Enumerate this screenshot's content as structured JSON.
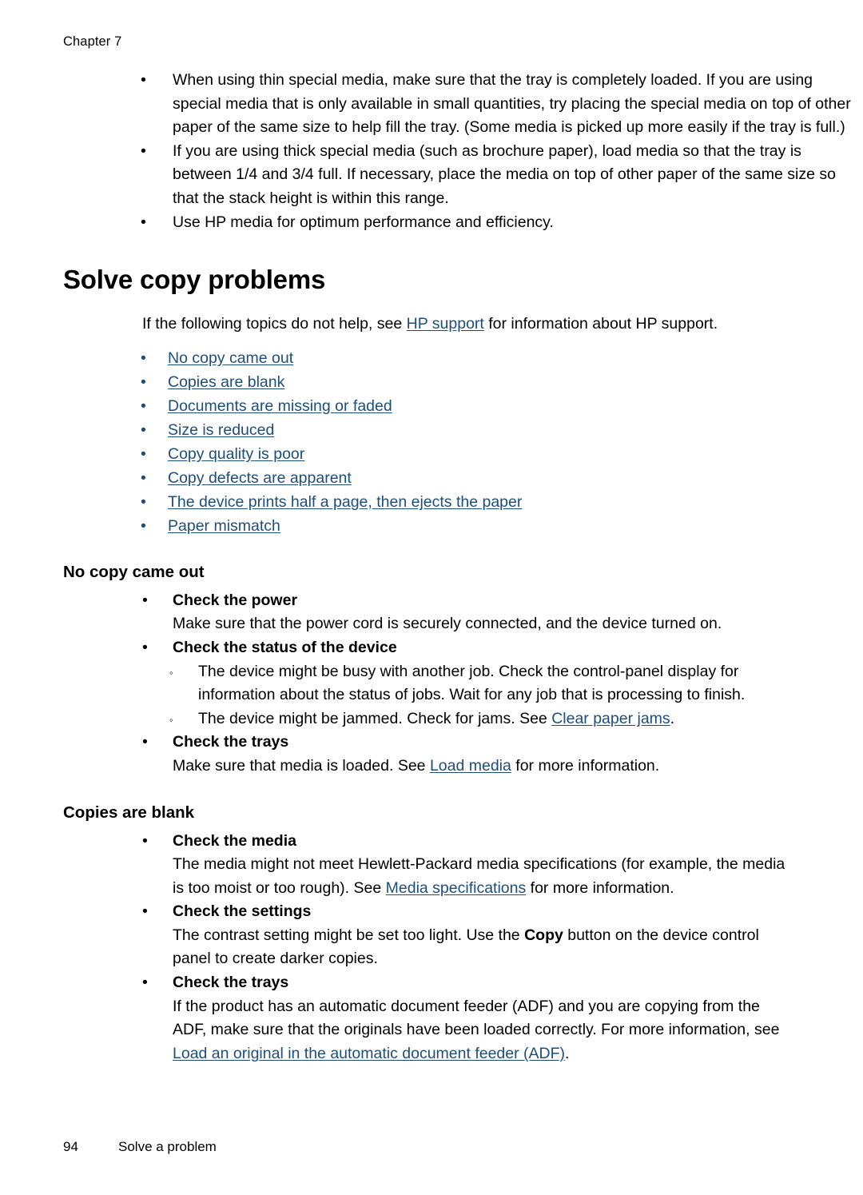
{
  "header": {
    "chapter": "Chapter 7"
  },
  "intro_bullets": [
    "When using thin special media, make sure that the tray is completely loaded. If you are using special media that is only available in small quantities, try placing the special media on top of other paper of the same size to help fill the tray. (Some media is picked up more easily if the tray is full.)",
    "If you are using thick special media (such as brochure paper), load media so that the tray is between 1/4 and 3/4 full. If necessary, place the media on top of other paper of the same size so that the stack height is within this range.",
    "Use HP media for optimum performance and efficiency."
  ],
  "main_heading": "Solve copy problems",
  "intro_paragraph": {
    "before": "If the following topics do not help, see ",
    "link": "HP support",
    "after": " for information about HP support."
  },
  "toc": [
    "No copy came out",
    "Copies are blank",
    "Documents are missing or faded",
    "Size is reduced",
    "Copy quality is poor",
    "Copy defects are apparent",
    "The device prints half a page, then ejects the paper",
    "Paper mismatch"
  ],
  "section_no_copy": {
    "heading": "No copy came out",
    "check_power": {
      "title": "Check the power",
      "body": "Make sure that the power cord is securely connected, and the device turned on."
    },
    "check_status": {
      "title": "Check the status of the device",
      "sub": [
        {
          "text": "The device might be busy with another job. Check the control-panel display for information about the status of jobs. Wait for any job that is processing to finish."
        }
      ],
      "sub_jam": {
        "before": "The device might be jammed. Check for jams. See ",
        "link": "Clear paper jams",
        "after": "."
      }
    },
    "check_trays": {
      "title": "Check the trays",
      "before": "Make sure that media is loaded. See ",
      "link": "Load media",
      "after": " for more information."
    }
  },
  "section_copies_blank": {
    "heading": "Copies are blank",
    "check_media": {
      "title": "Check the media",
      "before": "The media might not meet Hewlett-Packard media specifications (for example, the media is too moist or too rough). See ",
      "link": "Media specifications",
      "after": " for more information."
    },
    "check_settings": {
      "title": "Check the settings",
      "before": "The contrast setting might be set too light. Use the ",
      "bold": "Copy",
      "after": " button on the device control panel to create darker copies."
    },
    "check_trays": {
      "title": "Check the trays",
      "before": "If the product has an automatic document feeder (ADF) and you are copying from the ADF, make sure that the originals have been loaded correctly. For more information, see ",
      "link": "Load an original in the automatic document feeder (ADF)",
      "after": "."
    }
  },
  "footer": {
    "page_number": "94",
    "section_title": "Solve a problem"
  },
  "glyphs": {
    "bullet": "•",
    "circle": "◦"
  },
  "colors": {
    "link": "#1d4e79",
    "text": "#000000",
    "page_bg": "#ffffff"
  }
}
